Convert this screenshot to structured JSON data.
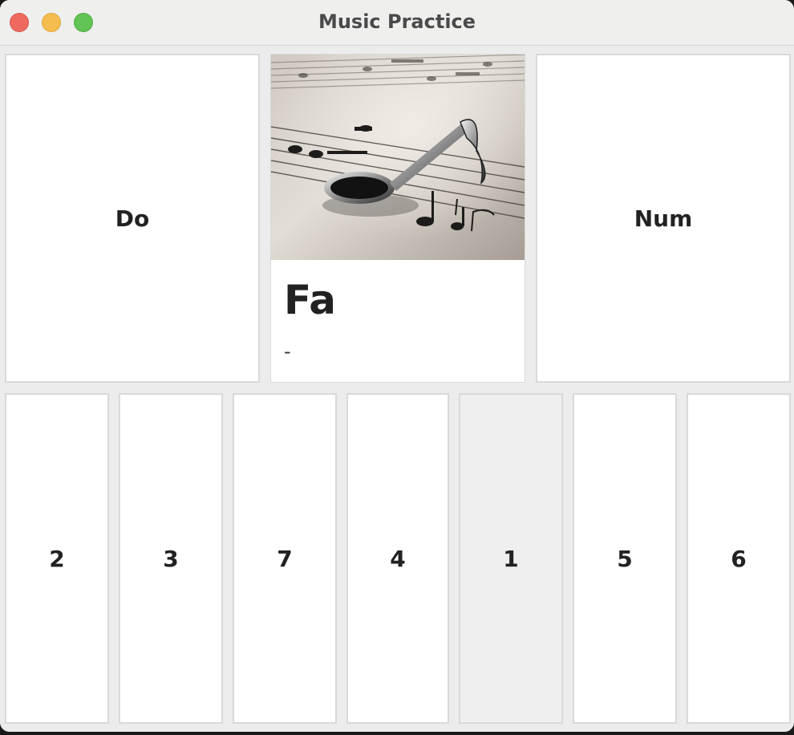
{
  "window": {
    "title": "Music Practice"
  },
  "top": {
    "left_label": "Do",
    "right_label": "Num",
    "note": {
      "name": "Fa",
      "subtitle": "-",
      "image_icon": "music-note-on-sheet-icon"
    }
  },
  "keys": [
    {
      "label": "2"
    },
    {
      "label": "3"
    },
    {
      "label": "7"
    },
    {
      "label": "4"
    },
    {
      "label": "1",
      "active": true
    },
    {
      "label": "5"
    },
    {
      "label": "6"
    }
  ],
  "colors": {
    "close": "#ee6a5f",
    "minimize": "#f5bd4f",
    "zoom": "#61c454",
    "card_bg": "#ffffff",
    "active_key_bg": "#efefef",
    "text": "#222222"
  }
}
